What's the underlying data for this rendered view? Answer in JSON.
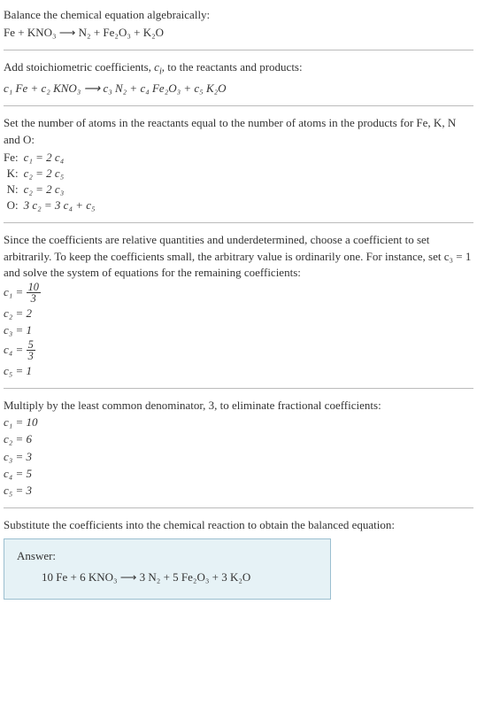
{
  "s1": {
    "title": "Balance the chemical equation algebraically:",
    "eq": "Fe + KNO₃  ⟶  N₂ + Fe₂O₃ + K₂O"
  },
  "s2": {
    "title_a": "Add stoichiometric coefficients, ",
    "title_ci": "c",
    "title_i": "i",
    "title_b": ", to the reactants and products:",
    "eq": "c₁ Fe + c₂ KNO₃  ⟶  c₃ N₂ + c₄ Fe₂O₃ + c₅ K₂O"
  },
  "s3": {
    "title": "Set the number of atoms in the reactants equal to the number of atoms in the products for Fe, K, N and O:",
    "rows": [
      {
        "label": "Fe:",
        "expr": "c₁ = 2 c₄"
      },
      {
        "label": "K:",
        "expr": "c₂ = 2 c₅"
      },
      {
        "label": "N:",
        "expr": "c₂ = 2 c₃"
      },
      {
        "label": "O:",
        "expr": "3 c₂ = 3 c₄ + c₅"
      }
    ]
  },
  "s4": {
    "title": "Since the coefficients are relative quantities and underdetermined, choose a coefficient to set arbitrarily. To keep the coefficients small, the arbitrary value is ordinarily one. For instance, set c₃ = 1 and solve the system of equations for the remaining coefficients:",
    "c1_lhs": "c₁ = ",
    "c1_num": "10",
    "c1_den": "3",
    "c2": "c₂ = 2",
    "c3": "c₃ = 1",
    "c4_lhs": "c₄ = ",
    "c4_num": "5",
    "c4_den": "3",
    "c5": "c₅ = 1"
  },
  "s5": {
    "title": "Multiply by the least common denominator, 3, to eliminate fractional coefficients:",
    "c1": "c₁ = 10",
    "c2": "c₂ = 6",
    "c3": "c₃ = 3",
    "c4": "c₄ = 5",
    "c5": "c₅ = 3"
  },
  "s6": {
    "title": "Substitute the coefficients into the chemical reaction to obtain the balanced equation:"
  },
  "answer": {
    "label": "Answer:",
    "eq": "10 Fe + 6 KNO₃  ⟶  3 N₂ + 5 Fe₂O₃ + 3 K₂O"
  },
  "chart_data": {
    "type": "table",
    "title": "Chemical equation balancing",
    "unbalanced_equation": "Fe + KNO3 -> N2 + Fe2O3 + K2O",
    "atom_balance_equations": {
      "Fe": "c1 = 2 c4",
      "K": "c2 = 2 c5",
      "N": "c2 = 2 c3",
      "O": "3 c2 = 3 c4 + c5"
    },
    "solution_fractional": {
      "c1": "10/3",
      "c2": 2,
      "c3": 1,
      "c4": "5/3",
      "c5": 1
    },
    "lcd": 3,
    "solution_integer": {
      "c1": 10,
      "c2": 6,
      "c3": 3,
      "c4": 5,
      "c5": 3
    },
    "balanced_equation": "10 Fe + 6 KNO3 -> 3 N2 + 5 Fe2O3 + 3 K2O"
  }
}
